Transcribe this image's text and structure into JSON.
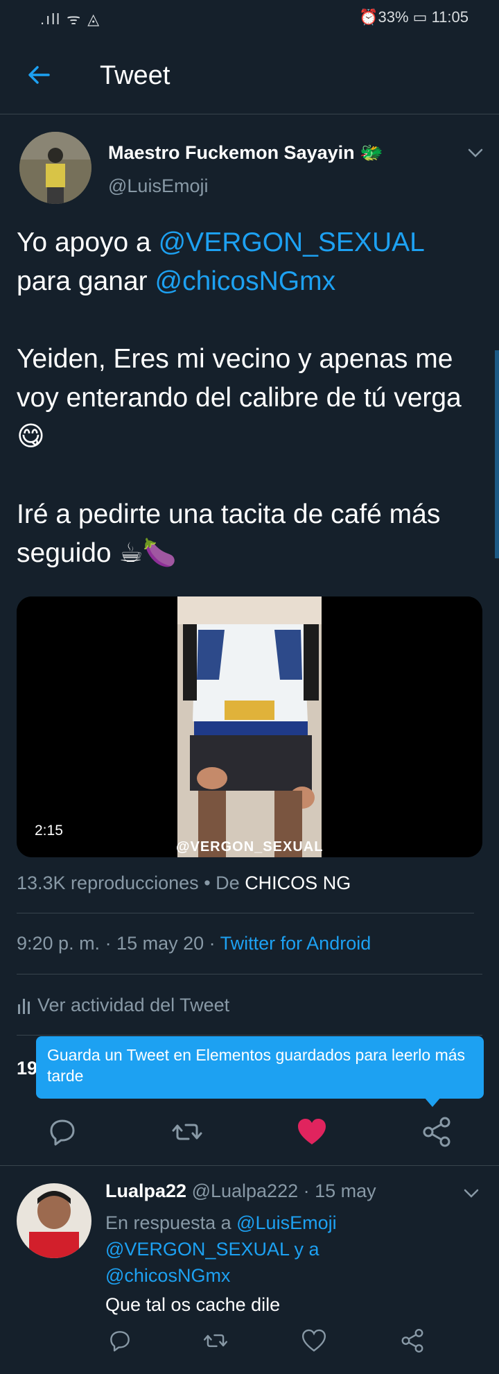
{
  "status_bar": {
    "signal": ".ıll ᯤ ◬",
    "battery": "33%",
    "time": "11:05",
    "right_text": "⏰33% ▭ 11:05"
  },
  "header": {
    "title": "Tweet"
  },
  "tweet": {
    "author_name": "Maestro Fuckemon Sayayin 🐲",
    "author_handle": "@LuisEmoji",
    "line1_prefix": "Yo apoyo a ",
    "mention1": "@VERGON_SEXUAL",
    "line2_prefix": "para ganar ",
    "mention2": "@chicosNGmx",
    "para2": "Yeiden, Eres mi vecino y apenas me voy enterando del calibre de tú verga 😋",
    "para3": "Iré a pedirte una tacita de café más seguido ☕🍆",
    "video": {
      "duration": "2:15",
      "watermark": "@VERGON_SEXUAL"
    },
    "views_text": "13.3K reproducciones",
    "separator": "•",
    "from_prefix": "De",
    "from_name": "CHICOS NG",
    "timestamp": "9:20 p. m. · 15 may 20 · ",
    "client": "Twitter for Android",
    "activity_label": "Ver actividad del Tweet",
    "stats_partial": "19"
  },
  "tooltip": {
    "text": "Guarda un Tweet en Elementos guardados para leerlo más tarde"
  },
  "reply": {
    "author_name": "Lualpa22",
    "author_handle": "@Lualpa222",
    "date": "· 15 may",
    "in_reply_prefix": "En respuesta a ",
    "in_reply_user": "@LuisEmoji",
    "in_reply_line2": "@VERGON_SEXUAL y a",
    "in_reply_line3": "@chicosNGmx",
    "text": "Que tal os cache dile"
  },
  "colors": {
    "background": "#15202b",
    "accent": "#1da1f2",
    "like": "#e0245e",
    "muted": "#8899a6",
    "divider": "#38444d"
  },
  "icons": [
    "back-arrow-icon",
    "chevron-down-icon",
    "reply-icon",
    "retweet-icon",
    "like-icon",
    "share-icon",
    "activity-bars-icon"
  ]
}
